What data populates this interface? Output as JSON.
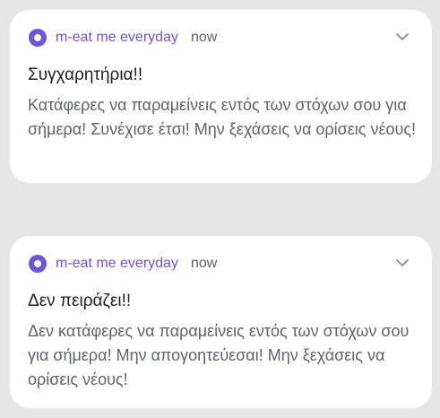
{
  "notifications": [
    {
      "app_name": "m-eat me everyday",
      "time": "now",
      "title": "Συγχαρητήρια!!",
      "body": "Κατάφερες να παραμείνεις εντός των στόχων σου για σήμερα! Συνέχισε έτσι! Μην ξεχάσεις να ορίσεις νέους!",
      "icon": "app-icon",
      "expand_icon": "chevron-down-icon"
    },
    {
      "app_name": "m-eat me everyday",
      "time": "now",
      "title": "Δεν πειράζει!!",
      "body": "Δεν κατάφερες να παραμείνεις εντός των στόχων σου για σήμερα! Μην απογοητεύεσαι! Μην ξεχάσεις να ορίσεις νέους!",
      "icon": "app-icon",
      "expand_icon": "chevron-down-icon"
    }
  ],
  "colors": {
    "accent": "#6d55d8",
    "background": "#e6e6e6",
    "card": "#ffffff",
    "title_text": "#1f1f1f",
    "secondary_text": "#5f6368"
  }
}
